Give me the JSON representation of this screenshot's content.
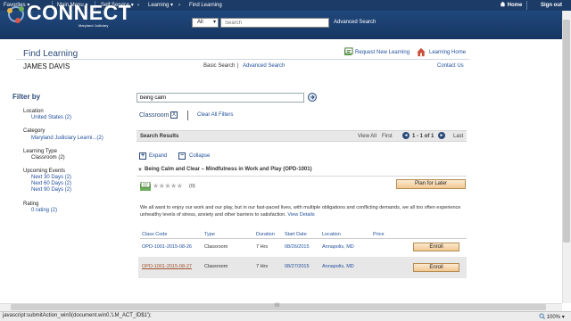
{
  "topnav": {
    "favorites": "Favorites",
    "main_menu": "Main Menu",
    "self_service": "Self Service",
    "learning": "Learning",
    "find_learning": "Find Learning",
    "home": "Home",
    "sign_out": "Sign out",
    "arrow": "▾",
    "chevron": "›"
  },
  "header": {
    "logo": "CONNECT",
    "logo_sub": "Maryland Judiciary",
    "search_scope": "All",
    "search_placeholder": "Search",
    "advanced_search": "Advanced Search",
    "colors": {
      "nav_bg": "#1c3b66",
      "header_bg": "#20487c"
    }
  },
  "page": {
    "title": "Find Learning",
    "user": "JAMES DAVIS",
    "basic_search": "Basic Search",
    "pipe": "|",
    "advanced_search": "Advanced Search",
    "request_new_learning": "Request New Learning",
    "learning_home": "Learning Home",
    "contact_us": "Contact Us"
  },
  "filters": {
    "title": "Filter by",
    "groups": [
      {
        "label": "Location",
        "values": [
          "United States (2)"
        ]
      },
      {
        "label": "Category",
        "values": [
          "Maryland Judiciary Learni...(2)"
        ]
      },
      {
        "label": "Learning Type",
        "values": [
          "Classroom (2)"
        ]
      },
      {
        "label": "Upcoming Events",
        "values": [
          "Next 30 Days (2)",
          "Next 60 Days (2)",
          "Next 90 Days (2)"
        ]
      },
      {
        "label": "Rating",
        "values": [
          "0 rating (2)"
        ]
      }
    ]
  },
  "search": {
    "query": "being calm",
    "chip": "Classroom",
    "chip_remove": "X",
    "clear_all": "Clear All Filters"
  },
  "results": {
    "title": "Search Results",
    "view_all": "View All",
    "first": "First",
    "prev": "◄",
    "page_info": "1 - 1 of 1",
    "next": "►",
    "last": "Last",
    "expand": "Expand",
    "collapse": "Collapse",
    "expand_symbol": "+",
    "collapse_symbol": "−"
  },
  "course": {
    "arrow": "▼",
    "title": "Being Calm and Clear – Mindfulness in Work and Play (OPD-1001)",
    "stars": "★★★★★",
    "rating_count": "(0)",
    "rating": 0,
    "plan_later": "Plan for Later",
    "description": "We all want to enjoy our work and our play, but in our fast-paced lives, with multiple obligations and conflicting demands, we all too often experience unhealthy levels of stress, anxiety and other barriers to satisfaction.",
    "view_details": "View Details"
  },
  "table": {
    "headers": [
      "Class Code",
      "Type",
      "Duration",
      "Start Date",
      "Location",
      "Price"
    ],
    "rows": [
      {
        "code": "OPD-1001-2015-08-26",
        "type": "Classroom",
        "duration": "7 Hrs",
        "start": "08/26/2015",
        "location": "Annapolis, MD",
        "action": "Enroll"
      },
      {
        "code": "OPD-1001-2015-08-27",
        "type": "Classroom",
        "duration": "7 Hrs",
        "start": "08/27/2015",
        "location": "Annapolis, MD",
        "action": "Enroll"
      }
    ]
  },
  "statusbar": {
    "text": "javascript:submitAction_win0(document.win0,'LM_ACT_ID$1');",
    "zoom": "100%",
    "grip": "III"
  }
}
